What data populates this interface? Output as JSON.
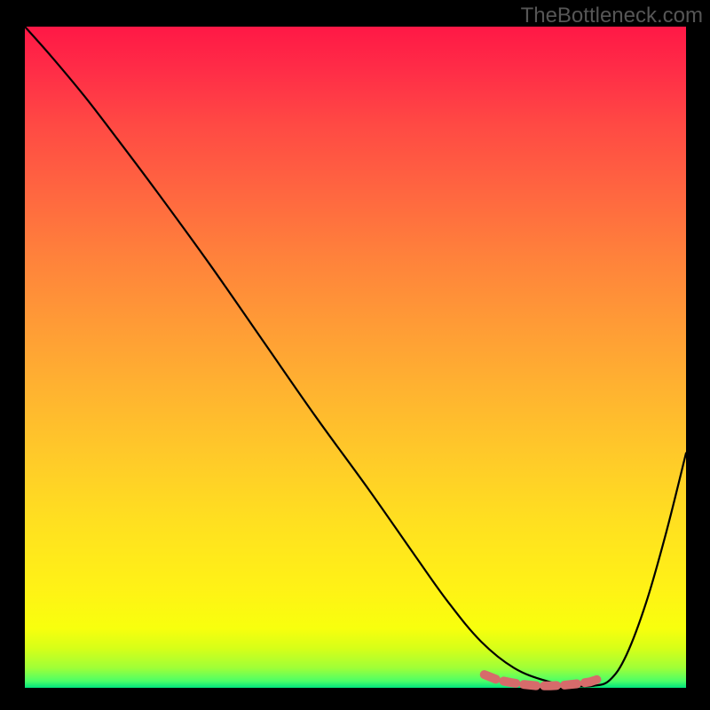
{
  "watermark": "TheBottleneck.com",
  "chart_data": {
    "type": "line",
    "title": "",
    "xlabel": "",
    "ylabel": "",
    "xlim": [
      0,
      1
    ],
    "ylim": [
      0,
      1
    ],
    "series": [
      {
        "name": "bottleneck-curve",
        "x": [
          0.0,
          0.04,
          0.09,
          0.14,
          0.2,
          0.28,
          0.36,
          0.44,
          0.52,
          0.59,
          0.64,
          0.69,
          0.74,
          0.79,
          0.83,
          0.86,
          0.885,
          0.91,
          0.94,
          0.97,
          1.0
        ],
        "y": [
          1.0,
          0.955,
          0.895,
          0.83,
          0.75,
          0.64,
          0.525,
          0.41,
          0.3,
          0.2,
          0.13,
          0.07,
          0.03,
          0.01,
          0.003,
          0.003,
          0.012,
          0.05,
          0.13,
          0.235,
          0.355
        ]
      },
      {
        "name": "bottom-marker-band",
        "x": [
          0.695,
          0.715,
          0.735,
          0.755,
          0.775,
          0.795,
          0.815,
          0.835,
          0.855,
          0.87
        ],
        "y": [
          0.02,
          0.012,
          0.008,
          0.005,
          0.003,
          0.003,
          0.004,
          0.006,
          0.009,
          0.014
        ]
      }
    ],
    "colors": {
      "curve": "#000000",
      "marker_band": "#d66b6b",
      "gradient_top": "#ff1846",
      "gradient_bottom": "#00e47e"
    }
  }
}
